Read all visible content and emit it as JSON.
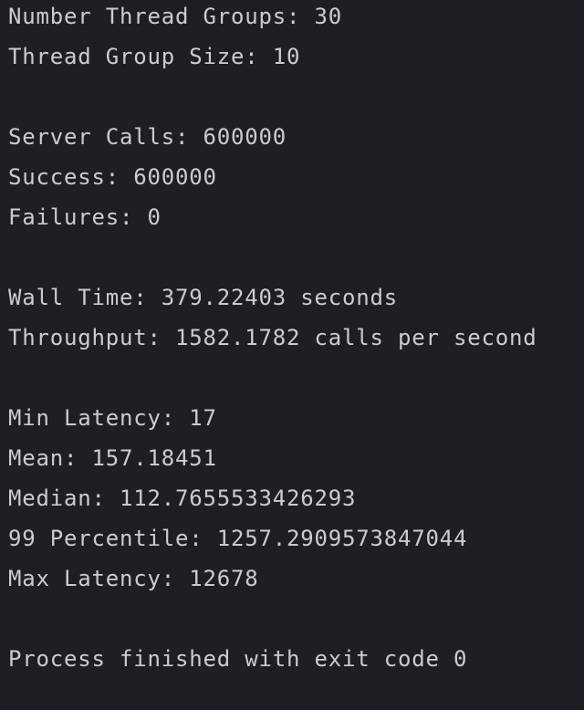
{
  "console": {
    "thread_config": {
      "number_thread_groups": "Number Thread Groups: 30",
      "thread_group_size": "Thread Group Size: 10"
    },
    "calls": {
      "server_calls": "Server Calls: 600000",
      "success": "Success: 600000",
      "failures": "Failures: 0"
    },
    "timing": {
      "wall_time": "Wall Time: 379.22403 seconds",
      "throughput": "Throughput: 1582.1782 calls per second"
    },
    "latency": {
      "min": "Min Latency: 17",
      "mean": "Mean: 157.18451",
      "median": "Median: 112.7655533426293",
      "p99": "99 Percentile: 1257.2909573847044",
      "max": "Max Latency: 12678"
    },
    "exit_message": "Process finished with exit code 0"
  },
  "colors": {
    "background": "#1e1f22",
    "text": "#c9ccd3"
  }
}
